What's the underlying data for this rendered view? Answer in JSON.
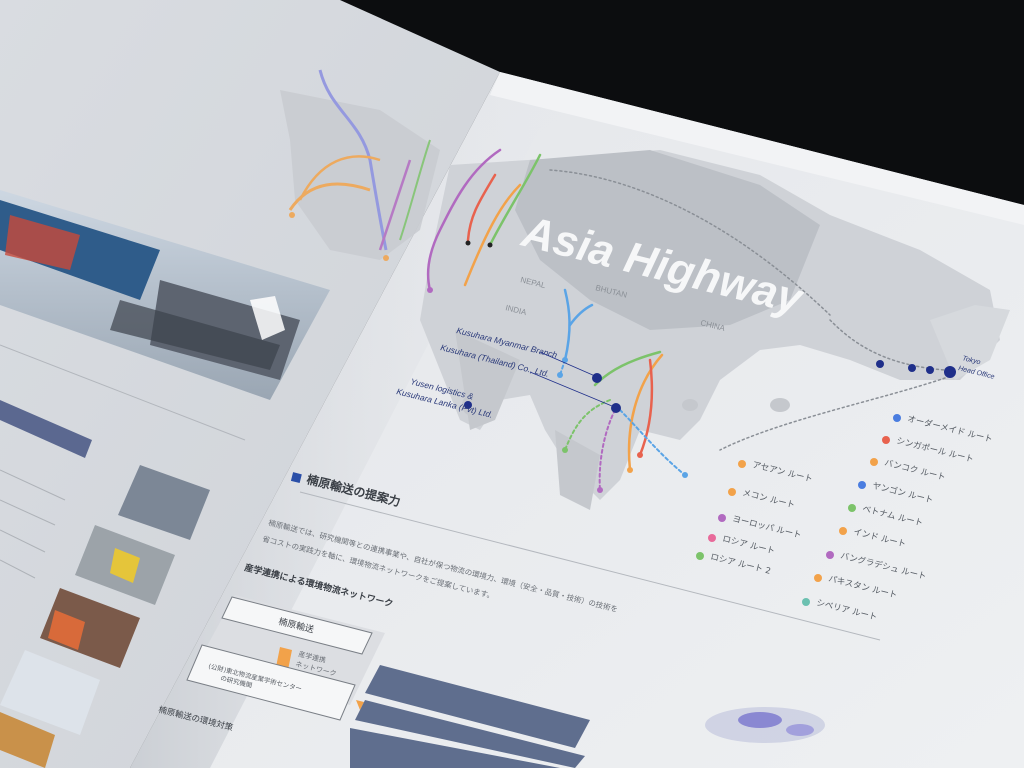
{
  "brochure": {
    "map_title": "Asia Highway",
    "section_heading": "楠原輸送の提案力",
    "section_body": "楠原輸送では、研究機関等との連携事業や、自社が保つ物流の環境力、環境（安全・品質・技術）の技術を",
    "section_body_2": "省コストの実践力を軸に、環境物流ネットワークをご提案しています。",
    "subheading": "産学連携による環境物流ネットワーク",
    "flow_top": "楠原輸送",
    "flow_middle_1": "産学連携",
    "flow_middle_2": "ネットワーク",
    "flow_bottom_1": "(公財)東北物流産業学術センター",
    "flow_bottom_2": "の研究機関",
    "left_heading": "楠原輸送の環境対策"
  },
  "branches": {
    "myanmar": "Kusuhara Myanmar Branch",
    "thailand": "Kusuhara (Thailand) Co., Ltd.",
    "lanka_1": "Yusen logistics &",
    "lanka_2": "Kusuhara Lanka (Pvt) Ltd.",
    "tokyo_1": "Tokyo",
    "tokyo_2": "Head Office"
  },
  "countries": {
    "china": "CHINA",
    "india": "INDIA",
    "nepal": "NEPAL",
    "bhutan": "BHUTAN"
  },
  "legend": {
    "left": [
      {
        "label": "アセアン ルート",
        "color": "#f2a24a"
      },
      {
        "label": "メコン ルート",
        "color": "#f2a24a"
      },
      {
        "label": "ヨーロッパ ルート",
        "color": "#b16ac0"
      },
      {
        "label": "ロシア ルート",
        "color": "#e86a9a"
      },
      {
        "label": "ロシア ルート 2",
        "color": "#7cc36a"
      }
    ],
    "right": [
      {
        "label": "オーダーメイド ルート",
        "color": "#4a7de0"
      },
      {
        "label": "シンガポール ルート",
        "color": "#e8624e"
      },
      {
        "label": "バンコク ルート",
        "color": "#f2a24a"
      },
      {
        "label": "ヤンゴン ルート",
        "color": "#4a7de0"
      },
      {
        "label": "ベトナム ルート",
        "color": "#7cc36a"
      },
      {
        "label": "インド ルート",
        "color": "#f2a24a"
      },
      {
        "label": "バングラデシュ ルート",
        "color": "#b16ac0"
      },
      {
        "label": "パキスタン ルート",
        "color": "#f2a24a"
      },
      {
        "label": "シベリア ルート",
        "color": "#6bc0b0"
      }
    ]
  },
  "route_colors": {
    "blue": "#4a7de0",
    "orange": "#f2a24a",
    "green": "#7cc36a",
    "purple": "#b16ac0",
    "red": "#e8624e",
    "navy": "#1f2f8a",
    "sky": "#5aa4e6"
  }
}
